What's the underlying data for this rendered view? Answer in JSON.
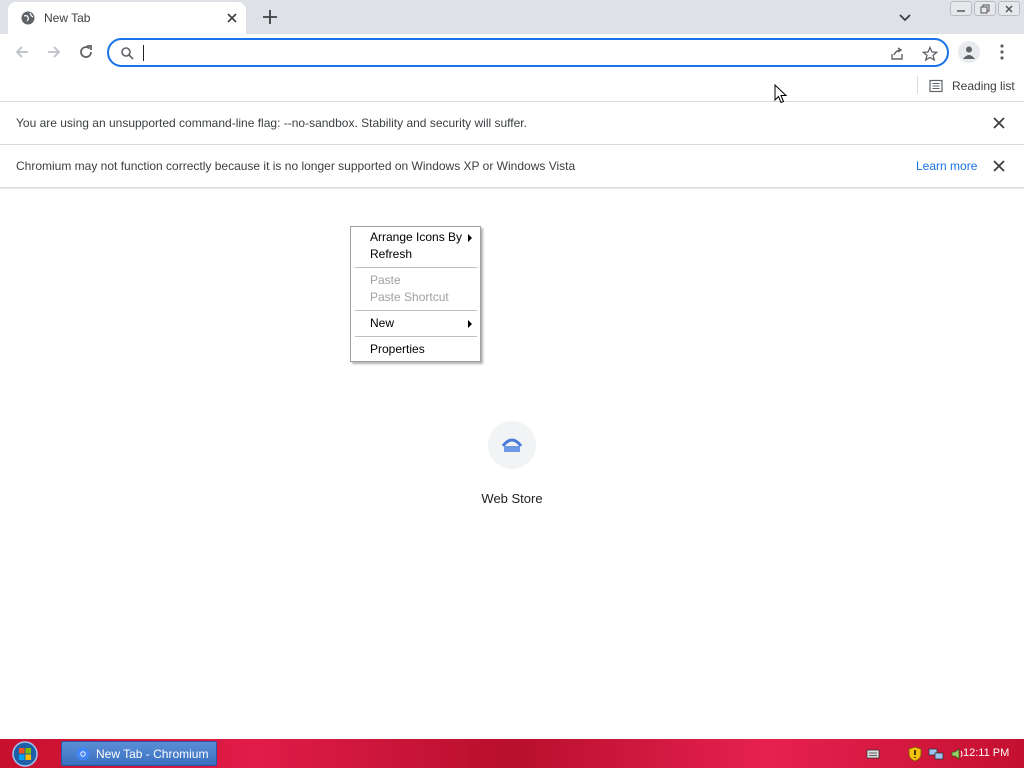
{
  "tab": {
    "title": "New Tab"
  },
  "toolbar": {
    "omnibox_value": "",
    "omnibox_placeholder": ""
  },
  "bookmarks_bar": {
    "reading_list_label": "Reading list"
  },
  "infobars": [
    {
      "text": "You are using an unsupported command-line flag: --no-sandbox. Stability and security will suffer."
    },
    {
      "text": "Chromium may not function correctly because it is no longer supported on Windows XP or Windows Vista",
      "link": "Learn more"
    }
  ],
  "shortcuts": [
    {
      "label": "Web Store",
      "icon": "web-store-icon"
    }
  ],
  "context_menu": {
    "items": [
      {
        "label": "Arrange Icons By",
        "submenu": true,
        "enabled": true
      },
      {
        "label": "Refresh",
        "submenu": false,
        "enabled": true
      },
      {
        "label": "Paste",
        "submenu": false,
        "enabled": false
      },
      {
        "label": "Paste Shortcut",
        "submenu": false,
        "enabled": false
      },
      {
        "label": "New",
        "submenu": true,
        "enabled": true
      },
      {
        "label": "Properties",
        "submenu": false,
        "enabled": true
      }
    ]
  },
  "taskbar": {
    "task_label": "New Tab - Chromium",
    "clock": "12:11 PM"
  },
  "colors": {
    "accent": "#1a73e8",
    "taskbar": "#c8102e",
    "tabstrip": "#dee1e6"
  }
}
